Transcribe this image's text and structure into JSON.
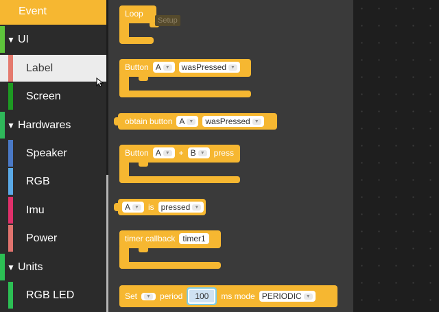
{
  "toolbox": {
    "items": [
      {
        "label": "Event",
        "kind": "sub",
        "color": "#f6b731"
      },
      {
        "label": "UI",
        "kind": "cat",
        "color": "#5ec43b"
      },
      {
        "label": "Label",
        "kind": "sub",
        "color": "#e57a6e",
        "selected": true
      },
      {
        "label": "Screen",
        "kind": "sub",
        "color": "#1d9a22"
      },
      {
        "label": "Hardwares",
        "kind": "cat",
        "color": "#2fb85a"
      },
      {
        "label": "Speaker",
        "kind": "sub",
        "color": "#4a79c6"
      },
      {
        "label": "RGB",
        "kind": "sub",
        "color": "#5aa9e6"
      },
      {
        "label": "Imu",
        "kind": "sub",
        "color": "#e0306a"
      },
      {
        "label": "Power",
        "kind": "sub",
        "color": "#e0736e"
      },
      {
        "label": "Units",
        "kind": "cat",
        "color": "#2cbf54"
      },
      {
        "label": "RGB LED",
        "kind": "sub",
        "color": "#2cbf54"
      }
    ],
    "arrow": "▼"
  },
  "blocks": {
    "loop": {
      "label": "Loop",
      "ghost": "Setup"
    },
    "button_was_pressed": {
      "prefix": "Button",
      "button": "A",
      "event": "wasPressed"
    },
    "obtain_button": {
      "prefix": "obtain button",
      "button": "A",
      "event": "wasPressed"
    },
    "button_combo": {
      "prefix": "Button",
      "button_a": "A",
      "plus": "+",
      "button_b": "B",
      "suffix": "press"
    },
    "button_is": {
      "button": "A",
      "is": "is",
      "state": "pressed"
    },
    "timer_callback": {
      "prefix": "timer callback",
      "timer": "timer1"
    },
    "set_timer": {
      "prefix": "Set",
      "period_label": "period",
      "period": "100",
      "mode_label": "ms mode",
      "mode": "PERIODIC"
    }
  },
  "colors": {
    "block": "#f6b731",
    "flyout": "#3a3a3a",
    "sidebar": "#2b2b2b",
    "workspace": "#1e1e1e"
  },
  "icons": {
    "caret": "▼",
    "cursor": "mouse-pointer-icon"
  }
}
